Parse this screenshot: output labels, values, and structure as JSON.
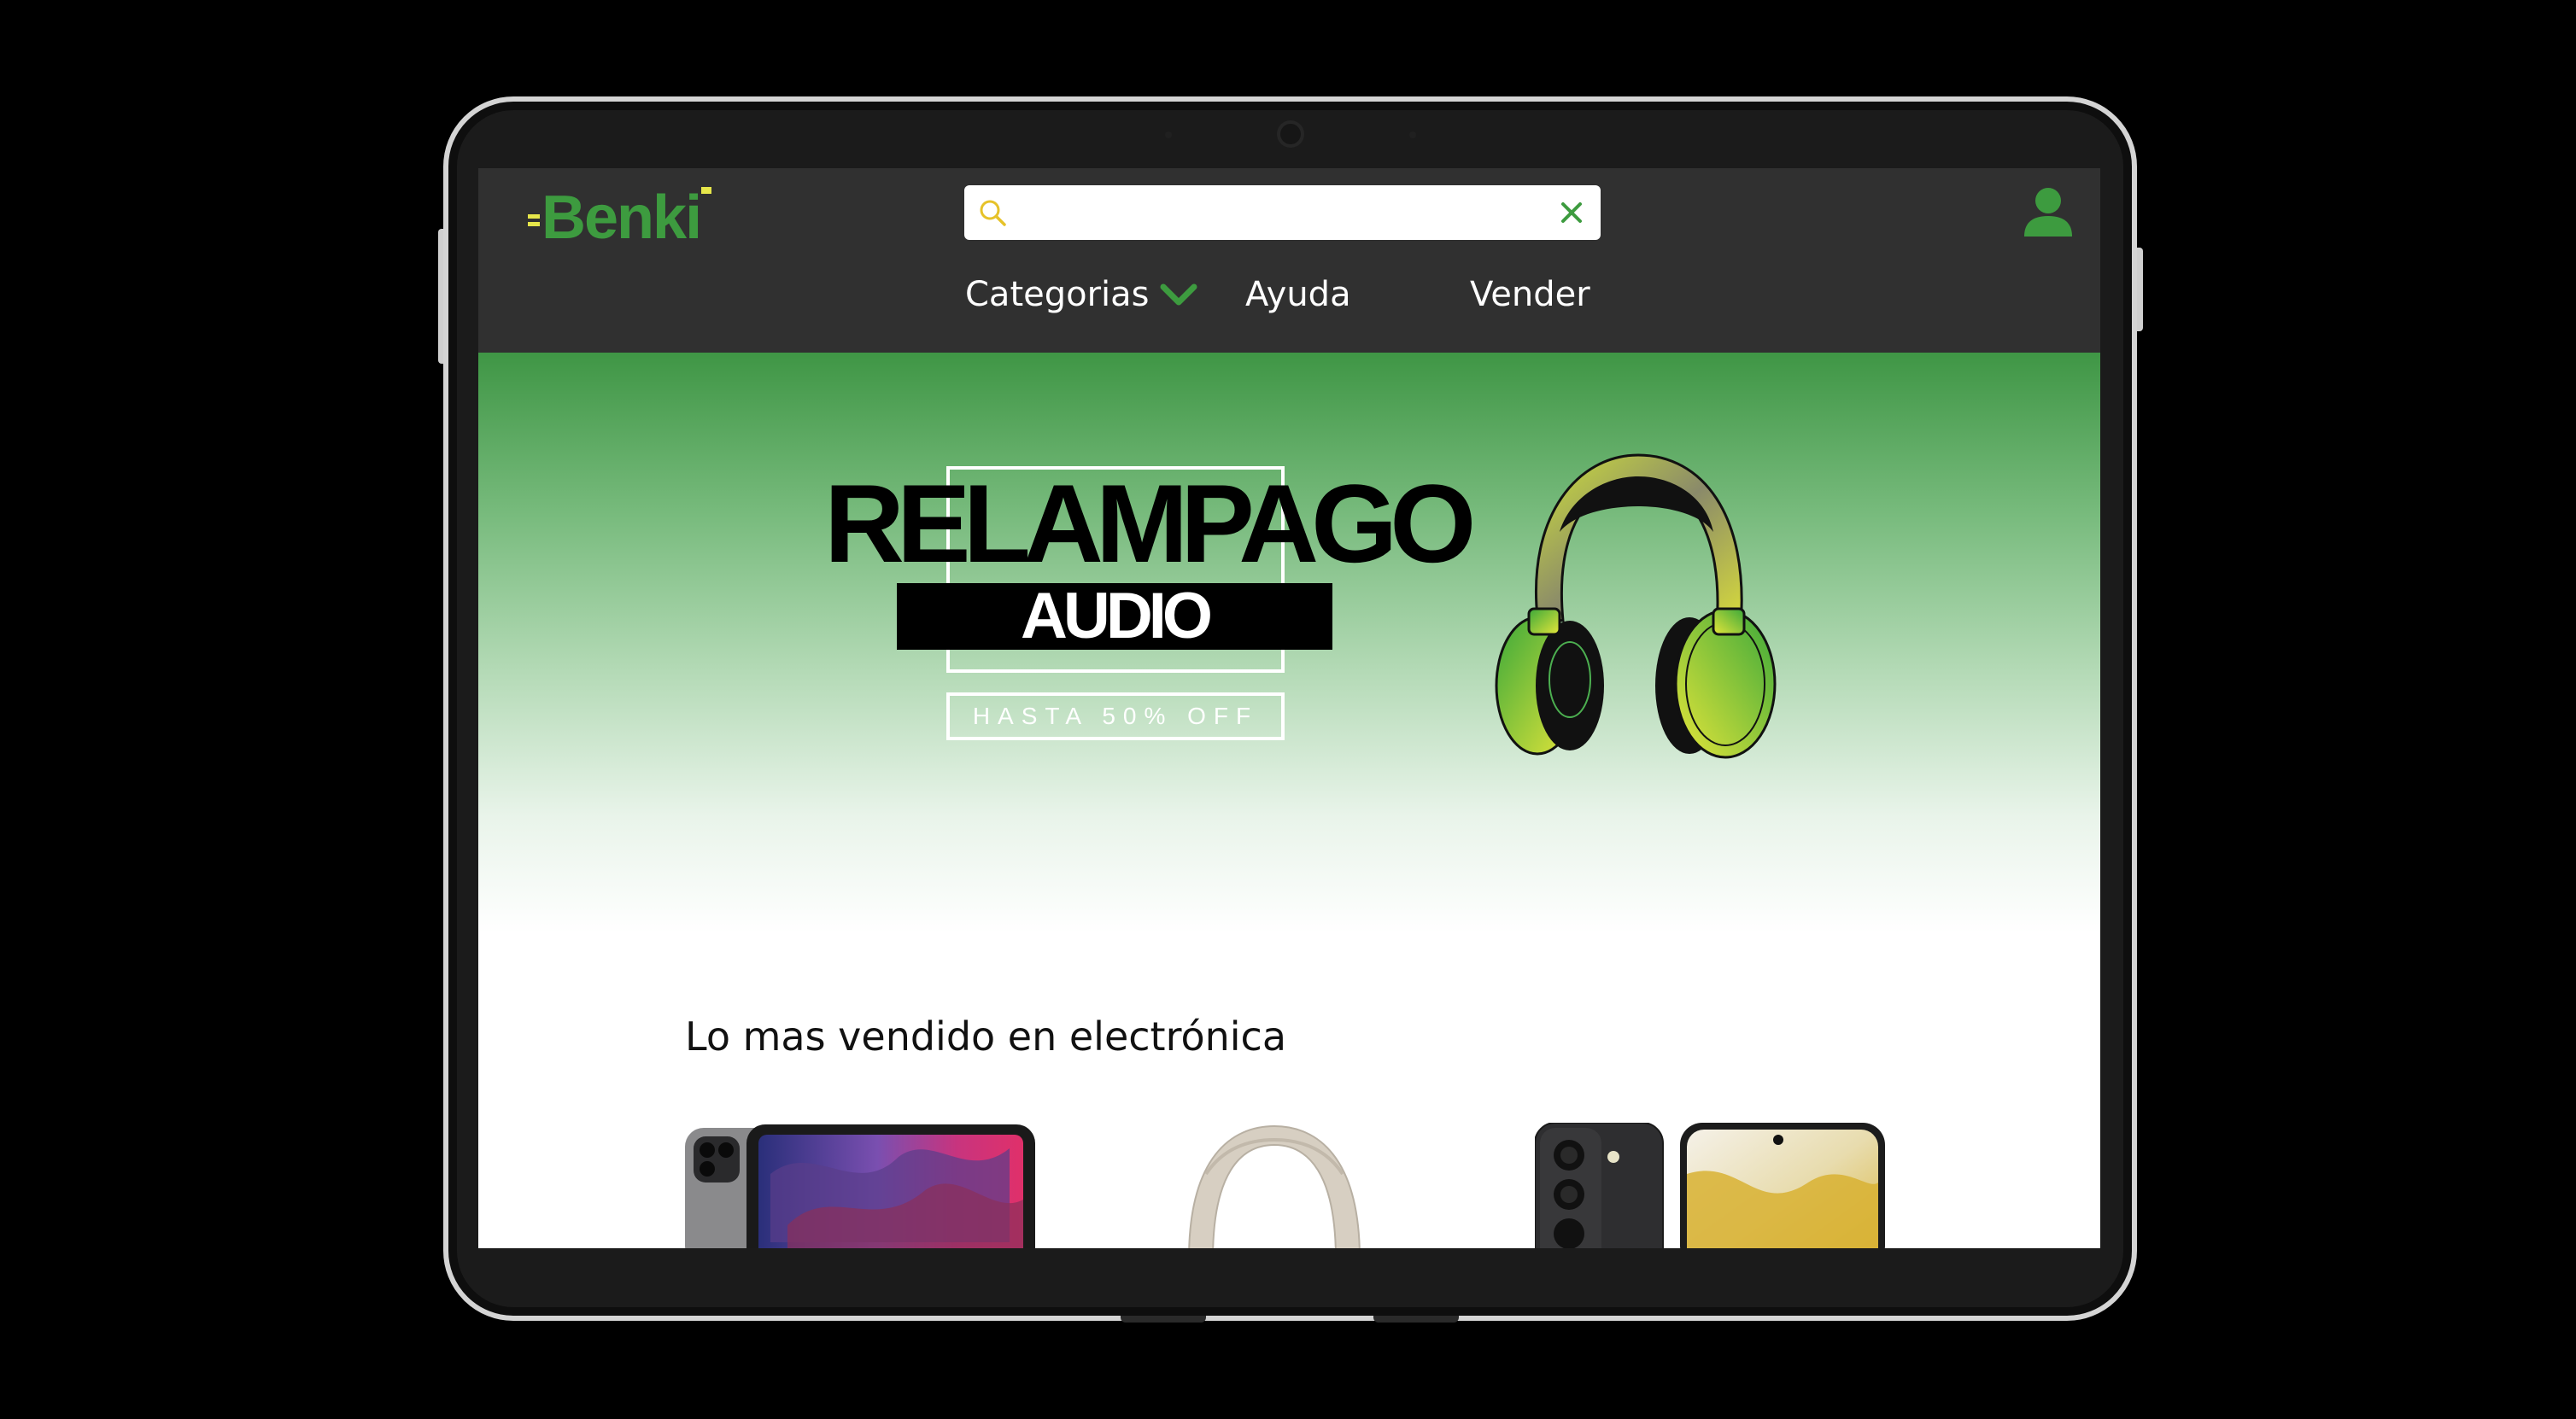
{
  "header": {
    "logo_text": "Benki",
    "search": {
      "value": "",
      "placeholder": ""
    },
    "nav": [
      {
        "label": "Categorias",
        "has_dropdown": true
      },
      {
        "label": "Ayuda"
      },
      {
        "label": "Vender"
      }
    ]
  },
  "hero": {
    "title": "RELAMPAGO",
    "subtitle": "AUDIO",
    "offer": "HASTA 50% OFF"
  },
  "bestsellers": {
    "title": "Lo mas vendido en electrónica",
    "products": [
      {
        "icon": "tablet-product-image"
      },
      {
        "icon": "headphones-product-image"
      },
      {
        "icon": "smartphone-product-image"
      }
    ]
  },
  "colors": {
    "brand_green": "#3d9b3f",
    "header_bg": "#303030",
    "logo_accent": "#e6e64a"
  }
}
